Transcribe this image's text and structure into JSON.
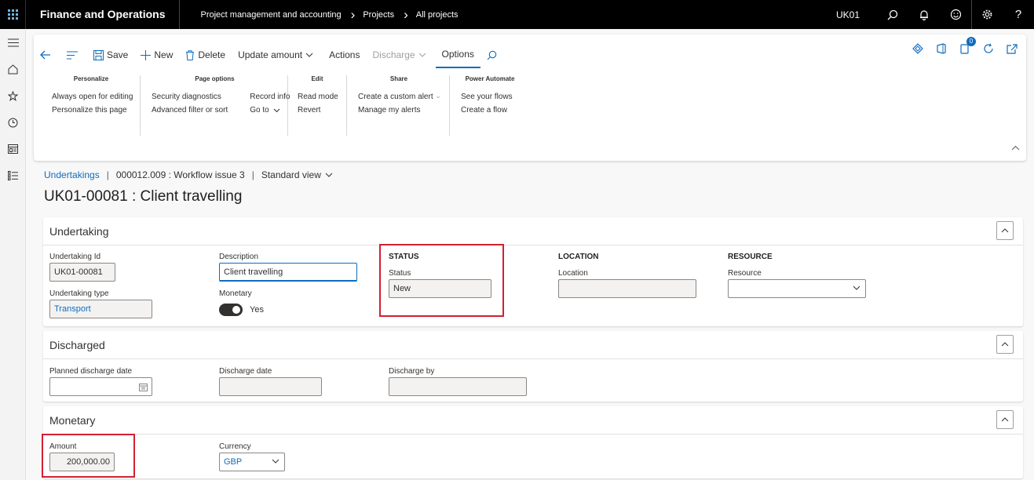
{
  "topbar": {
    "app_title": "Finance and Operations",
    "breadcrumb": [
      "Project management and accounting",
      "Projects",
      "All projects"
    ],
    "company": "UK01"
  },
  "actionbar": {
    "save": "Save",
    "new": "New",
    "delete": "Delete",
    "update_amount": "Update amount",
    "actions": "Actions",
    "discharge": "Discharge",
    "options": "Options",
    "notification_count": "0"
  },
  "ribbon": {
    "personalize": {
      "title": "Personalize",
      "items": [
        "Always open for editing",
        "Personalize this page"
      ]
    },
    "page_options": {
      "title": "Page options",
      "col1": [
        "Security diagnostics",
        "Advanced filter or sort"
      ],
      "col2": [
        "Record info",
        "Go to"
      ]
    },
    "edit": {
      "title": "Edit",
      "items": [
        "Read mode",
        "Revert"
      ]
    },
    "share": {
      "title": "Share",
      "items": [
        "Create a custom alert",
        "Manage my alerts"
      ]
    },
    "power_automate": {
      "title": "Power Automate",
      "items": [
        "See your flows",
        "Create a flow"
      ]
    }
  },
  "pathbar": {
    "link": "Undertakings",
    "record": "000012.009 : Workflow issue 3",
    "view": "Standard view"
  },
  "page_title": "UK01-00081 : Client travelling",
  "undertaking": {
    "header": "Undertaking",
    "id_label": "Undertaking Id",
    "id_value": "UK01-00081",
    "type_label": "Undertaking type",
    "type_value": "Transport",
    "desc_label": "Description",
    "desc_value": "Client travelling",
    "monetary_label": "Monetary",
    "monetary_value": "Yes",
    "status_section": "STATUS",
    "status_label": "Status",
    "status_value": "New",
    "location_section": "LOCATION",
    "location_label": "Location",
    "location_value": "",
    "resource_section": "RESOURCE",
    "resource_label": "Resource",
    "resource_value": ""
  },
  "discharged": {
    "header": "Discharged",
    "planned_label": "Planned discharge date",
    "planned_value": "",
    "date_label": "Discharge date",
    "date_value": "",
    "by_label": "Discharge by",
    "by_value": ""
  },
  "monetary": {
    "header": "Monetary",
    "amount_label": "Amount",
    "amount_value": "200,000.00",
    "currency_label": "Currency",
    "currency_value": "GBP"
  },
  "colors": {
    "accent": "#0f6cbd",
    "highlight": "#d32030",
    "topbar": "#000000"
  }
}
